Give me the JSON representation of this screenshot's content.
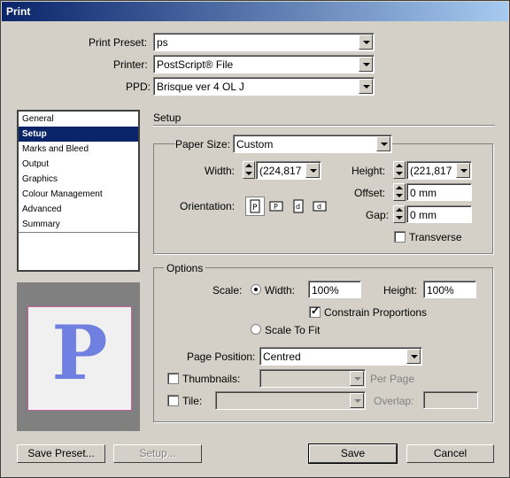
{
  "window": {
    "title": "Print"
  },
  "header": {
    "preset": {
      "label": "Print Preset:",
      "value": "ps"
    },
    "printer": {
      "label": "Printer:",
      "value": "PostScript® File"
    },
    "ppd": {
      "label": "PPD:",
      "value": "Brisque ver 4 OL J"
    }
  },
  "sidebar": {
    "items": [
      {
        "label": "General"
      },
      {
        "label": "Setup"
      },
      {
        "label": "Marks and Bleed"
      },
      {
        "label": "Output"
      },
      {
        "label": "Graphics"
      },
      {
        "label": "Colour Management"
      },
      {
        "label": "Advanced"
      },
      {
        "label": "Summary"
      }
    ],
    "selected": "Setup"
  },
  "preview": {
    "letter": "P"
  },
  "setup": {
    "title": "Setup",
    "paper_size": {
      "label": "Paper Size:",
      "value": "Custom"
    },
    "width": {
      "label": "Width:",
      "value": "(224,817"
    },
    "height": {
      "label": "Height:",
      "value": "(221,817"
    },
    "offset": {
      "label": "Offset:",
      "value": "0 mm"
    },
    "gap": {
      "label": "Gap:",
      "value": "0 mm"
    },
    "orientation": {
      "label": "Orientation:"
    },
    "transverse": {
      "label": "Transverse",
      "checked": false
    }
  },
  "options": {
    "title": "Options",
    "scale_label": "Scale:",
    "scale_width": {
      "label": "Width:",
      "value": "100%"
    },
    "scale_height": {
      "label": "Height:",
      "value": "100%"
    },
    "constrain": {
      "label": "Constrain Proportions",
      "checked": true
    },
    "scale_to_fit": {
      "label": "Scale To Fit"
    },
    "page_position": {
      "label": "Page Position:",
      "value": "Centred"
    },
    "thumbnails": {
      "label": "Thumbnails:",
      "suffix": "Per Page"
    },
    "tile": {
      "label": "Tile:",
      "overlap_label": "Overlap:"
    }
  },
  "buttons": {
    "save_preset": "Save Preset...",
    "setup": "Setup...",
    "save": "Save",
    "cancel": "Cancel"
  }
}
